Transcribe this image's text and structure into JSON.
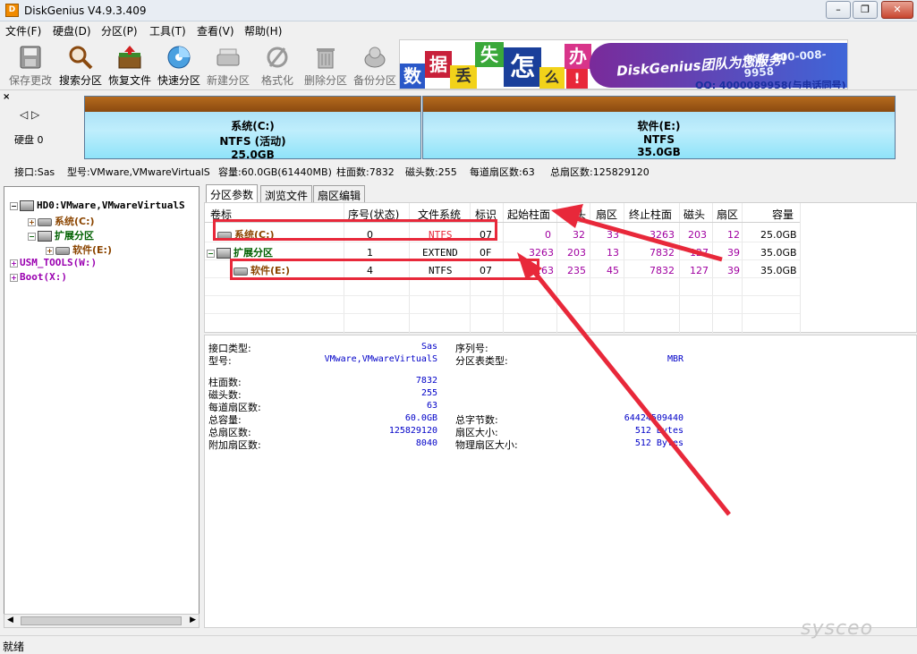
{
  "window": {
    "title": "DiskGenius V4.9.3.409",
    "app_icon": "D",
    "min": "–",
    "max": "❐",
    "close": "✕"
  },
  "menu": [
    "文件(F)",
    "硬盘(D)",
    "分区(P)",
    "工具(T)",
    "查看(V)",
    "帮助(H)"
  ],
  "toolbar": [
    {
      "label": "保存更改",
      "icon": "save-icon",
      "disabled": true
    },
    {
      "label": "搜索分区",
      "icon": "magnifier-icon",
      "disabled": false
    },
    {
      "label": "恢复文件",
      "icon": "recover-box-icon",
      "disabled": false
    },
    {
      "label": "快速分区",
      "icon": "quick-partition-disc-icon",
      "disabled": false
    },
    {
      "label": "新建分区",
      "icon": "new-partition-icon",
      "disabled": true
    },
    {
      "label": "格式化",
      "icon": "format-icon",
      "disabled": true
    },
    {
      "label": "删除分区",
      "icon": "trash-icon",
      "disabled": true
    },
    {
      "label": "备份分区",
      "icon": "backup-icon",
      "disabled": true
    }
  ],
  "banner": {
    "chars": [
      "数",
      "据",
      "丢",
      "失",
      "怎",
      "么",
      "办",
      "!"
    ],
    "slogan": "DiskGenius团队为您服务!",
    "phone": "电话: 400-008-9958",
    "qq": "QQ: 4000089958(与电话同号)"
  },
  "disk_map": {
    "nav": "◁ ▷",
    "label": "硬盘 0",
    "partitions": [
      {
        "name": "系统(C:)",
        "fs": "NTFS (活动)",
        "size": "25.0GB"
      },
      {
        "name": "软件(E:)",
        "fs": "NTFS",
        "size": "35.0GB"
      }
    ]
  },
  "disk_info_line": {
    "interface": "接口:Sas",
    "model": "型号:VMware,VMwareVirtualS",
    "capacity": "容量:60.0GB(61440MB)",
    "cylinders": "柱面数:7832",
    "heads": "磁头数:255",
    "sectors_per_track": "每道扇区数:63",
    "total_sectors": "总扇区数:125829120"
  },
  "tree": {
    "root": "HD0:VMware,VMwareVirtualS",
    "items": [
      "系统(C:)",
      "扩展分区",
      "软件(E:)",
      "USM_TOOLS(W:)",
      "Boot(X:)"
    ]
  },
  "tabs": [
    "分区参数",
    "浏览文件",
    "扇区编辑"
  ],
  "table": {
    "headers": [
      "卷标",
      "序号(状态)",
      "文件系统",
      "标识",
      "起始柱面",
      "磁头",
      "扇区",
      "终止柱面",
      "磁头",
      "扇区",
      "容量"
    ],
    "rows": [
      {
        "name": "系统(C:)",
        "index": "0",
        "fs": "NTFS",
        "id": "07",
        "start_cyl": "0",
        "start_head": "32",
        "start_sec": "33",
        "end_cyl": "3263",
        "end_head": "203",
        "end_sec": "12",
        "size": "25.0GB"
      },
      {
        "name": "扩展分区",
        "index": "1",
        "fs": "EXTEND",
        "id": "0F",
        "start_cyl": "3263",
        "start_head": "203",
        "start_sec": "13",
        "end_cyl": "7832",
        "end_head": "127",
        "end_sec": "39",
        "size": "35.0GB"
      },
      {
        "name": "软件(E:)",
        "index": "4",
        "fs": "NTFS",
        "id": "07",
        "start_cyl": "3263",
        "start_head": "235",
        "start_sec": "45",
        "end_cyl": "7832",
        "end_head": "127",
        "end_sec": "39",
        "size": "35.0GB"
      }
    ]
  },
  "details": {
    "interface_label": "接口类型:",
    "interface_val": "Sas",
    "serial_label": "序列号:",
    "serial_val": "",
    "model_label": "型号:",
    "model_val": "VMware,VMwareVirtualS",
    "ptable_label": "分区表类型:",
    "ptable_val": "MBR",
    "cyl_label": "柱面数:",
    "cyl_val": "7832",
    "heads_label": "磁头数:",
    "heads_val": "255",
    "spt_label": "每道扇区数:",
    "spt_val": "63",
    "cap_label": "总容量:",
    "cap_val": "60.0GB",
    "bytes_label": "总字节数:",
    "bytes_val": "64424509440",
    "sectors_label": "总扇区数:",
    "sectors_val": "125829120",
    "secsize_label": "扇区大小:",
    "secsize_val": "512 Bytes",
    "extra_label": "附加扇区数:",
    "extra_val": "8040",
    "phys_label": "物理扇区大小:",
    "phys_val": "512 Bytes"
  },
  "status": "就绪",
  "watermark": "sysceo",
  "colors": {
    "annotation_red": "#e8283a",
    "partition_brown": "#8a4a10",
    "partition_blue": "#9fd8f2",
    "row_system": "#8b4500",
    "row_extended": "#006000",
    "row_value_purple": "#a000a0",
    "detail_value": "#0000c8"
  }
}
